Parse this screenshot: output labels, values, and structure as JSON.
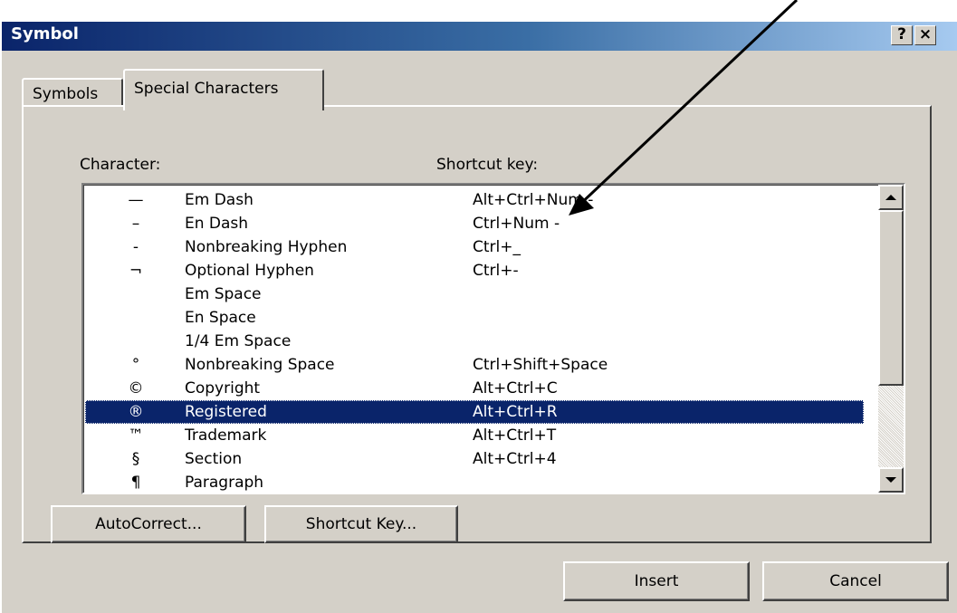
{
  "window": {
    "title": "Symbol",
    "help_label": "?",
    "close_label": "×"
  },
  "tabs": [
    {
      "label": "Symbols"
    },
    {
      "label": "Special Characters"
    }
  ],
  "list": {
    "character_header": "Character:",
    "shortcut_header": "Shortcut key:",
    "rows": [
      {
        "symbol": "—",
        "name": "Em Dash",
        "shortcut": "Alt+Ctrl+Num -"
      },
      {
        "symbol": "–",
        "name": "En Dash",
        "shortcut": "Ctrl+Num -"
      },
      {
        "symbol": "-",
        "name": "Nonbreaking Hyphen",
        "shortcut": "Ctrl+_"
      },
      {
        "symbol": "¬",
        "name": "Optional Hyphen",
        "shortcut": "Ctrl+-"
      },
      {
        "symbol": "",
        "name": "Em Space",
        "shortcut": ""
      },
      {
        "symbol": "",
        "name": "En Space",
        "shortcut": ""
      },
      {
        "symbol": "",
        "name": "1/4 Em Space",
        "shortcut": ""
      },
      {
        "symbol": "°",
        "name": "Nonbreaking Space",
        "shortcut": "Ctrl+Shift+Space"
      },
      {
        "symbol": "©",
        "name": "Copyright",
        "shortcut": "Alt+Ctrl+C"
      },
      {
        "symbol": "®",
        "name": "Registered",
        "shortcut": "Alt+Ctrl+R"
      },
      {
        "symbol": "™",
        "name": "Trademark",
        "shortcut": "Alt+Ctrl+T"
      },
      {
        "symbol": "§",
        "name": "Section",
        "shortcut": "Alt+Ctrl+4"
      },
      {
        "symbol": "¶",
        "name": "Paragraph",
        "shortcut": ""
      }
    ],
    "selected_name": "Registered"
  },
  "buttons": {
    "autocorrect": "AutoCorrect...",
    "shortcut_key": "Shortcut Key...",
    "insert": "Insert",
    "cancel": "Cancel"
  },
  "colors": {
    "face": "#d4d0c8",
    "selection": "#0a246a",
    "title_start": "#0a246a",
    "title_end": "#a6caf0"
  }
}
